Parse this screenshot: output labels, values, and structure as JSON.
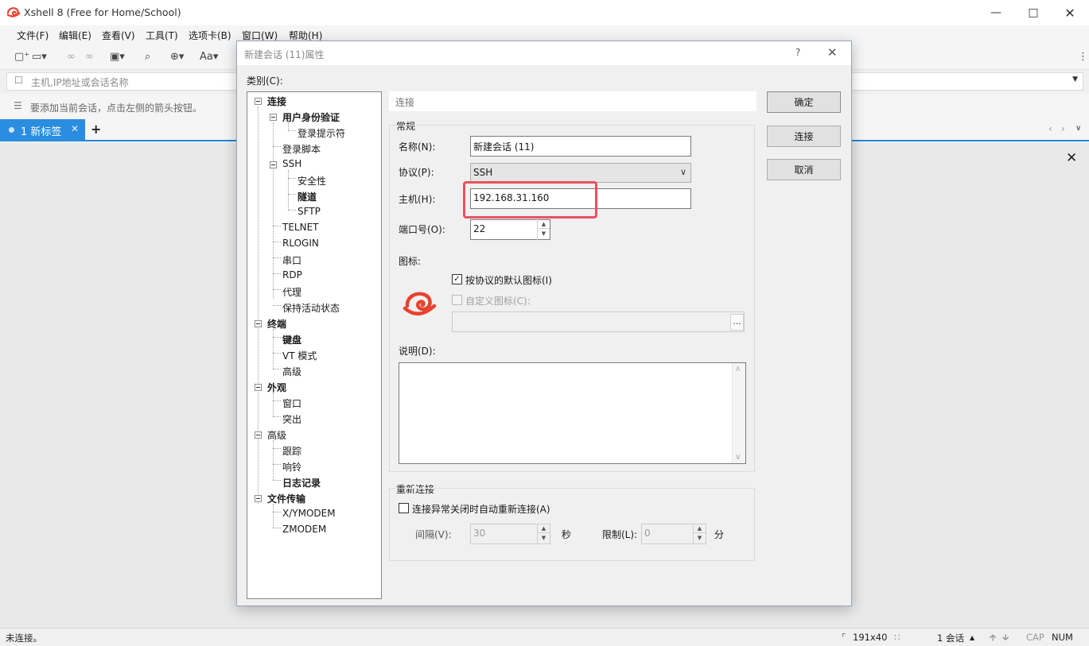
{
  "app": {
    "title": "Xshell 8 (Free for Home/School)",
    "menu": [
      "文件(F)",
      "编辑(E)",
      "查看(V)",
      "工具(T)",
      "选项卡(B)",
      "窗口(W)",
      "帮助(H)"
    ],
    "address_placeholder": "主机,IP地址或会话名称",
    "hint": "要添加当前会话，点击左侧的箭头按钮。",
    "tab_label": "1 新标签",
    "toolbar_font_label": "Aa",
    "accent_color": "#2b8de0"
  },
  "status": {
    "left": "未连接。",
    "size": "191x40",
    "sessions": "1 会话",
    "cap": "CAP",
    "num": "NUM"
  },
  "dialog": {
    "title": "新建会话 (11)属性",
    "help": "?",
    "category_label": "类别(C):",
    "page_header": "连接",
    "tree": [
      {
        "label": "连接",
        "bold": true
      },
      {
        "label": "用户身份验证",
        "bold": true
      },
      {
        "label": "登录提示符",
        "bold": false
      },
      {
        "label": "登录脚本",
        "bold": false
      },
      {
        "label": "SSH",
        "bold": false
      },
      {
        "label": "安全性",
        "bold": false
      },
      {
        "label": "隧道",
        "bold": true
      },
      {
        "label": "SFTP",
        "bold": false
      },
      {
        "label": "TELNET",
        "bold": false
      },
      {
        "label": "RLOGIN",
        "bold": false
      },
      {
        "label": "串口",
        "bold": false
      },
      {
        "label": "RDP",
        "bold": false
      },
      {
        "label": "代理",
        "bold": false
      },
      {
        "label": "保持活动状态",
        "bold": false
      },
      {
        "label": "终端",
        "bold": true
      },
      {
        "label": "键盘",
        "bold": true
      },
      {
        "label": "VT 模式",
        "bold": false
      },
      {
        "label": "高级",
        "bold": false
      },
      {
        "label": "外观",
        "bold": true
      },
      {
        "label": "窗口",
        "bold": false
      },
      {
        "label": "突出",
        "bold": false
      },
      {
        "label": "高级",
        "bold": false
      },
      {
        "label": "跟踪",
        "bold": false
      },
      {
        "label": "响铃",
        "bold": false
      },
      {
        "label": "日志记录",
        "bold": true
      },
      {
        "label": "文件传输",
        "bold": true
      },
      {
        "label": "X/YMODEM",
        "bold": false
      },
      {
        "label": "ZMODEM",
        "bold": false
      }
    ],
    "general": {
      "group_label": "常规",
      "name_label": "名称(N):",
      "name_value": "新建会话 (11)",
      "protocol_label": "协议(P):",
      "protocol_value": "SSH",
      "host_label": "主机(H):",
      "host_value": "192.168.31.160",
      "port_label": "端口号(O):",
      "port_value": "22",
      "icon_label": "图标:",
      "default_icon_label": "按协议的默认图标(I)",
      "default_icon_checked": true,
      "custom_icon_label": "自定义图标(C):",
      "custom_icon_checked": false,
      "browse_label": "...",
      "desc_label": "说明(D):"
    },
    "reconnect": {
      "group_label": "重新连接",
      "auto_label": "连接异常关闭时自动重新连接(A)",
      "auto_checked": false,
      "interval_label": "间隔(V):",
      "interval_value": "30",
      "interval_unit": "秒",
      "limit_label": "限制(L):",
      "limit_value": "0",
      "limit_unit": "分"
    },
    "buttons": {
      "ok": "确定",
      "connect": "连接",
      "cancel": "取消"
    },
    "highlight_color": "#e8525f"
  }
}
